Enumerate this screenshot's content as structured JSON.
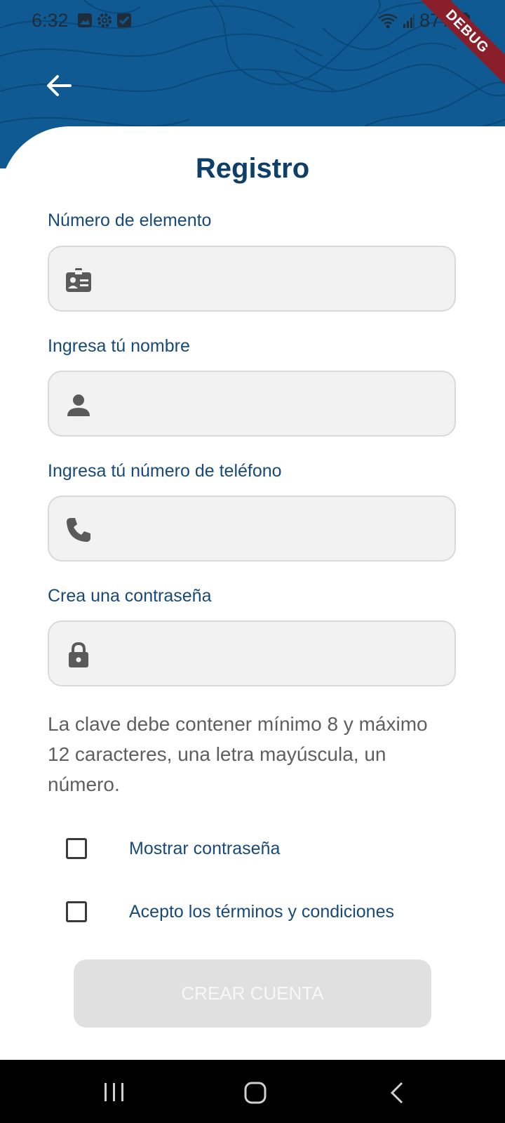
{
  "status_bar": {
    "time": "6:32",
    "battery": "87%",
    "icons": [
      "image-icon",
      "settings-icon",
      "checkbox-icon",
      "wifi-icon",
      "signal-icon",
      "battery-icon"
    ]
  },
  "debug_banner": "DEBUG",
  "header": {
    "back_icon": "arrow-back-icon",
    "color": "#0f5a92"
  },
  "title": "Registro",
  "fields": [
    {
      "label": "Número de elemento",
      "value": "",
      "icon": "badge-icon"
    },
    {
      "label": "Ingresa tú nombre",
      "value": "",
      "icon": "person-icon"
    },
    {
      "label": "Ingresa tú número de teléfono",
      "value": "",
      "icon": "phone-icon"
    },
    {
      "label": "Crea una contraseña",
      "value": "",
      "icon": "lock-icon"
    }
  ],
  "password_hint": "La clave debe contener mínimo 8 y máximo 12 caracteres, una letra mayúscula, un número.",
  "checkboxes": [
    {
      "label": "Mostrar contraseña",
      "checked": false
    },
    {
      "label": "Acepto los términos y condiciones",
      "checked": false
    }
  ],
  "submit_button": {
    "label": "CREAR CUENTA",
    "enabled": false
  },
  "nav_bar": {
    "icons": [
      "recents-icon",
      "home-icon",
      "back-icon"
    ]
  },
  "colors": {
    "primary": "#0e3f68",
    "label": "#174a78",
    "field_bg": "#f2f2f2",
    "button_disabled": "#e0e0e0"
  }
}
